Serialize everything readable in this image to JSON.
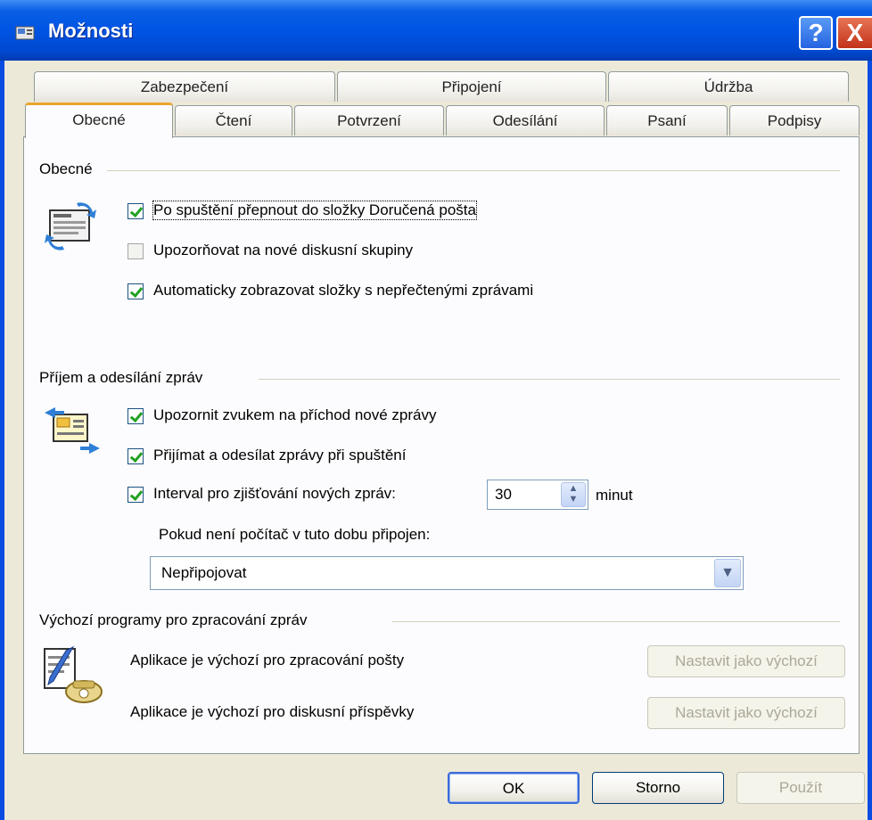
{
  "window": {
    "title": "Možnosti",
    "help_glyph": "?",
    "close_glyph": "X"
  },
  "tabs": {
    "row1": [
      "Zabezpečení",
      "Připojení",
      "Údržba"
    ],
    "row2": [
      "Obecné",
      "Čtení",
      "Potvrzení",
      "Odesílání",
      "Psaní",
      "Podpisy"
    ],
    "active": "Obecné"
  },
  "general": {
    "group_label": "Obecné",
    "options": [
      {
        "label": "Po spuštění přepnout do složky Doručená pošta",
        "checked": true
      },
      {
        "label": "Upozorňovat na nové diskusní skupiny",
        "checked": false
      },
      {
        "label": "Automaticky zobrazovat složky s nepřečtenými zprávami",
        "checked": true
      }
    ]
  },
  "send_receive": {
    "group_label": "Příjem a odesílání zpráv",
    "options": [
      {
        "label": "Upozornit zvukem na příchod nové zprávy",
        "checked": true
      },
      {
        "label": "Přijímat a odesílat zprávy při spuštění",
        "checked": true
      },
      {
        "label": "Interval pro zjišťování nových zpráv:",
        "checked": true
      }
    ],
    "interval_value": "30",
    "interval_unit": "minut",
    "offline_label": "Pokud není počítač v tuto dobu připojen:",
    "offline_selected": "Nepřipojovat"
  },
  "defaults": {
    "group_label": "Výchozí programy pro zpracování zpráv",
    "mail_text": "Aplikace je výchozí pro zpracování pošty",
    "news_text": "Aplikace je výchozí pro diskusní příspěvky",
    "set_default_label": "Nastavit jako výchozí"
  },
  "footer": {
    "ok": "OK",
    "cancel": "Storno",
    "apply": "Použít"
  },
  "colors": {
    "titlebar": "#0054e3",
    "face": "#ece9d8",
    "check": "#21a121",
    "active_tab_accent": "#e9a52f"
  }
}
